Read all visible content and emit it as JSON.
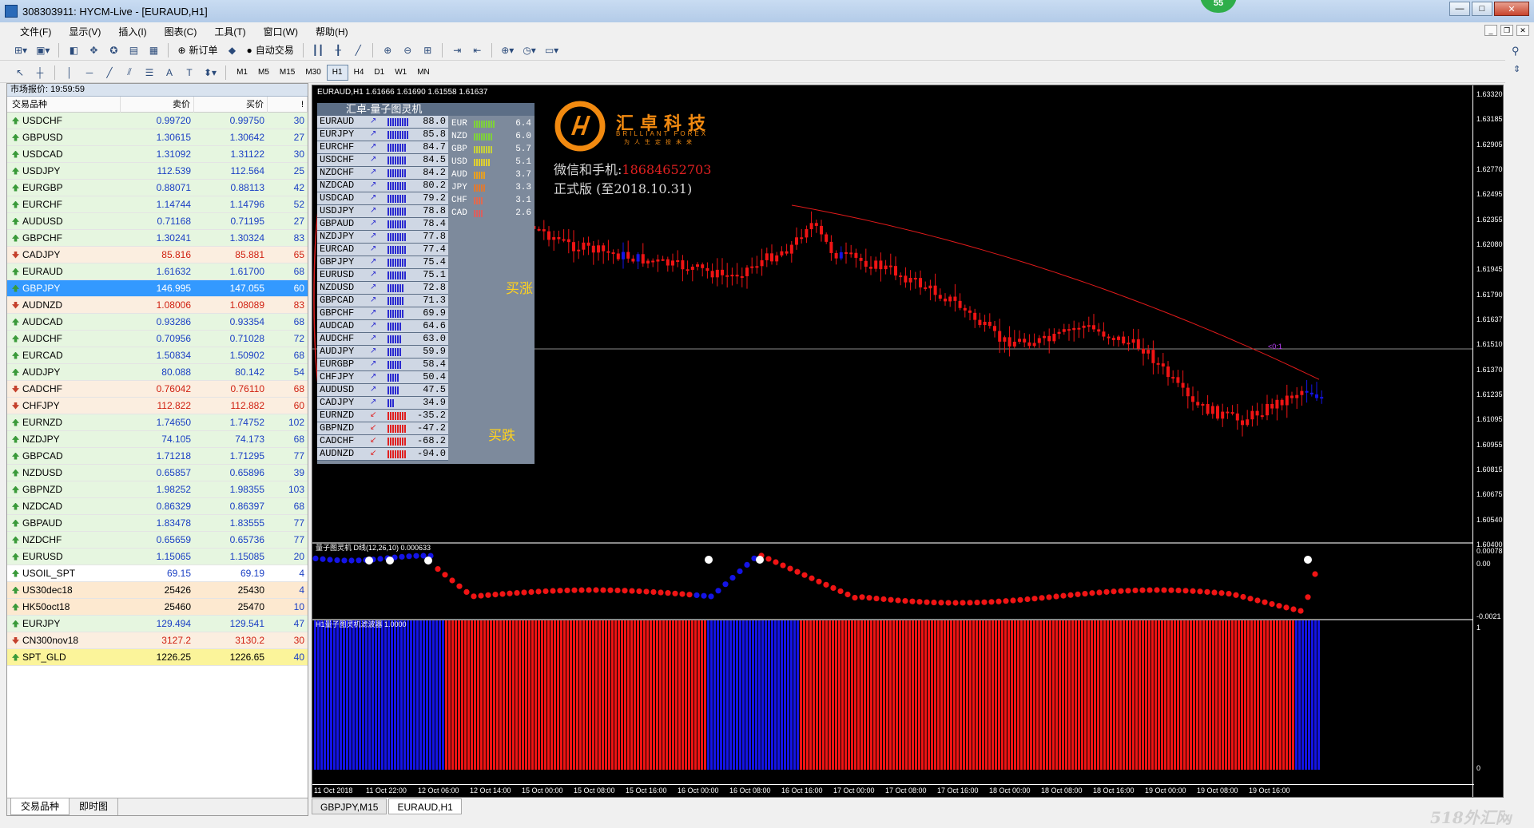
{
  "window": {
    "title": "308303911: HYCM-Live - [EURAUD,H1]",
    "badge": "55"
  },
  "menu": [
    "文件(F)",
    "显示(V)",
    "插入(I)",
    "图表(C)",
    "工具(T)",
    "窗口(W)",
    "帮助(H)"
  ],
  "toolbar": {
    "new_order": "新订单",
    "auto_trade": "自动交易",
    "timeframes": [
      "M1",
      "M5",
      "M15",
      "M30",
      "H1",
      "H4",
      "D1",
      "W1",
      "MN"
    ],
    "active_tf": "H1"
  },
  "market_watch": {
    "header": "市场报价: 19:59:59",
    "columns": [
      "交易品种",
      "卖价",
      "买价",
      "!"
    ],
    "rows": [
      {
        "sym": "USDCHF",
        "bid": "0.99720",
        "ask": "0.99750",
        "spread": "30",
        "state": "up"
      },
      {
        "sym": "GBPUSD",
        "bid": "1.30615",
        "ask": "1.30642",
        "spread": "27",
        "state": "up"
      },
      {
        "sym": "USDCAD",
        "bid": "1.31092",
        "ask": "1.31122",
        "spread": "30",
        "state": "up"
      },
      {
        "sym": "USDJPY",
        "bid": "112.539",
        "ask": "112.564",
        "spread": "25",
        "state": "up"
      },
      {
        "sym": "EURGBP",
        "bid": "0.88071",
        "ask": "0.88113",
        "spread": "42",
        "state": "up"
      },
      {
        "sym": "EURCHF",
        "bid": "1.14744",
        "ask": "1.14796",
        "spread": "52",
        "state": "up"
      },
      {
        "sym": "AUDUSD",
        "bid": "0.71168",
        "ask": "0.71195",
        "spread": "27",
        "state": "up"
      },
      {
        "sym": "GBPCHF",
        "bid": "1.30241",
        "ask": "1.30324",
        "spread": "83",
        "state": "up"
      },
      {
        "sym": "CADJPY",
        "bid": "85.816",
        "ask": "85.881",
        "spread": "65",
        "state": "down"
      },
      {
        "sym": "EURAUD",
        "bid": "1.61632",
        "ask": "1.61700",
        "spread": "68",
        "state": "up"
      },
      {
        "sym": "GBPJPY",
        "bid": "146.995",
        "ask": "147.055",
        "spread": "60",
        "state": "selected"
      },
      {
        "sym": "AUDNZD",
        "bid": "1.08006",
        "ask": "1.08089",
        "spread": "83",
        "state": "down"
      },
      {
        "sym": "AUDCAD",
        "bid": "0.93286",
        "ask": "0.93354",
        "spread": "68",
        "state": "up"
      },
      {
        "sym": "AUDCHF",
        "bid": "0.70956",
        "ask": "0.71028",
        "spread": "72",
        "state": "up"
      },
      {
        "sym": "EURCAD",
        "bid": "1.50834",
        "ask": "1.50902",
        "spread": "68",
        "state": "up"
      },
      {
        "sym": "AUDJPY",
        "bid": "80.088",
        "ask": "80.142",
        "spread": "54",
        "state": "up"
      },
      {
        "sym": "CADCHF",
        "bid": "0.76042",
        "ask": "0.76110",
        "spread": "68",
        "state": "down"
      },
      {
        "sym": "CHFJPY",
        "bid": "112.822",
        "ask": "112.882",
        "spread": "60",
        "state": "down"
      },
      {
        "sym": "EURNZD",
        "bid": "1.74650",
        "ask": "1.74752",
        "spread": "102",
        "state": "up"
      },
      {
        "sym": "NZDJPY",
        "bid": "74.105",
        "ask": "74.173",
        "spread": "68",
        "state": "up"
      },
      {
        "sym": "GBPCAD",
        "bid": "1.71218",
        "ask": "1.71295",
        "spread": "77",
        "state": "up"
      },
      {
        "sym": "NZDUSD",
        "bid": "0.65857",
        "ask": "0.65896",
        "spread": "39",
        "state": "up"
      },
      {
        "sym": "GBPNZD",
        "bid": "1.98252",
        "ask": "1.98355",
        "spread": "103",
        "state": "up"
      },
      {
        "sym": "NZDCAD",
        "bid": "0.86329",
        "ask": "0.86397",
        "spread": "68",
        "state": "up"
      },
      {
        "sym": "GBPAUD",
        "bid": "1.83478",
        "ask": "1.83555",
        "spread": "77",
        "state": "up"
      },
      {
        "sym": "NZDCHF",
        "bid": "0.65659",
        "ask": "0.65736",
        "spread": "77",
        "state": "up"
      },
      {
        "sym": "EURUSD",
        "bid": "1.15065",
        "ask": "1.15085",
        "spread": "20",
        "state": "up"
      },
      {
        "sym": "USOIL_SPT",
        "bid": "69.15",
        "ask": "69.19",
        "spread": "4",
        "state": "neutral"
      },
      {
        "sym": "US30dec18",
        "bid": "25426",
        "ask": "25430",
        "spread": "4",
        "state": "orange"
      },
      {
        "sym": "HK50oct18",
        "bid": "25460",
        "ask": "25470",
        "spread": "10",
        "state": "orange"
      },
      {
        "sym": "EURJPY",
        "bid": "129.494",
        "ask": "129.541",
        "spread": "47",
        "state": "up"
      },
      {
        "sym": "CN300nov18",
        "bid": "3127.2",
        "ask": "3130.2",
        "spread": "30",
        "state": "down"
      },
      {
        "sym": "SPT_GLD",
        "bid": "1226.25",
        "ask": "1226.65",
        "spread": "40",
        "state": "gold"
      }
    ],
    "tabs": [
      "交易品种",
      "即时图"
    ]
  },
  "chart": {
    "header": "EURAUD,H1  1.61666 1.61690 1.61558 1.61637",
    "panel_title": "汇卓-量子图灵机",
    "pairs": [
      {
        "p": "EURAUD",
        "v": "88.0",
        "s": "buy"
      },
      {
        "p": "EURJPY",
        "v": "85.8",
        "s": "buy"
      },
      {
        "p": "EURCHF",
        "v": "84.7",
        "s": "buy"
      },
      {
        "p": "USDCHF",
        "v": "84.5",
        "s": "buy"
      },
      {
        "p": "NZDCHF",
        "v": "84.2",
        "s": "buy"
      },
      {
        "p": "NZDCAD",
        "v": "80.2",
        "s": "buy"
      },
      {
        "p": "USDCAD",
        "v": "79.2",
        "s": "buy"
      },
      {
        "p": "USDJPY",
        "v": "78.8",
        "s": "buy"
      },
      {
        "p": "GBPAUD",
        "v": "78.4",
        "s": "buy"
      },
      {
        "p": "NZDJPY",
        "v": "77.8",
        "s": "buy"
      },
      {
        "p": "EURCAD",
        "v": "77.4",
        "s": "buy"
      },
      {
        "p": "GBPJPY",
        "v": "75.4",
        "s": "buy"
      },
      {
        "p": "EURUSD",
        "v": "75.1",
        "s": "buy"
      },
      {
        "p": "NZDUSD",
        "v": "72.8",
        "s": "buy"
      },
      {
        "p": "GBPCAD",
        "v": "71.3",
        "s": "buy"
      },
      {
        "p": "GBPCHF",
        "v": "69.9",
        "s": "buy"
      },
      {
        "p": "AUDCAD",
        "v": "64.6",
        "s": "buy"
      },
      {
        "p": "AUDCHF",
        "v": "63.0",
        "s": "buy"
      },
      {
        "p": "AUDJPY",
        "v": "59.9",
        "s": "buy"
      },
      {
        "p": "EURGBP",
        "v": "58.4",
        "s": "buy"
      },
      {
        "p": "CHFJPY",
        "v": "50.4",
        "s": "buy"
      },
      {
        "p": "AUDUSD",
        "v": "47.5",
        "s": "buy"
      },
      {
        "p": "CADJPY",
        "v": "34.9",
        "s": "buy"
      },
      {
        "p": "EURNZD",
        "v": "-35.2",
        "s": "sell"
      },
      {
        "p": "GBPNZD",
        "v": "-47.2",
        "s": "sell"
      },
      {
        "p": "CADCHF",
        "v": "-68.2",
        "s": "sell"
      },
      {
        "p": "AUDNZD",
        "v": "-94.0",
        "s": "sell"
      }
    ],
    "currencies": [
      {
        "c": "EUR",
        "v": "6.4",
        "col": "#7fd23a"
      },
      {
        "c": "NZD",
        "v": "6.0",
        "col": "#7fd23a"
      },
      {
        "c": "GBP",
        "v": "5.7",
        "col": "#c9d23a"
      },
      {
        "c": "USD",
        "v": "5.1",
        "col": "#e0d030"
      },
      {
        "c": "AUD",
        "v": "3.7",
        "col": "#e8a020"
      },
      {
        "c": "JPY",
        "v": "3.3",
        "col": "#e07a30"
      },
      {
        "c": "CHF",
        "v": "3.1",
        "col": "#e06a50"
      },
      {
        "c": "CAD",
        "v": "2.6",
        "col": "#d86060"
      }
    ],
    "brand": "汇卓科技",
    "brand_en": "BRILLIANT FOREX",
    "brand_cn2": "为人生定投未来",
    "contact_label": "微信和手机:",
    "contact_phone": "18684652703",
    "edition": "正式版 (至2018.10.31)",
    "annot_buy_up": "买涨",
    "annot_buy_down": "买跌",
    "price_labels": [
      "1.63320",
      "1.63185",
      "1.62905",
      "1.62770",
      "1.62495",
      "1.62355",
      "1.62080",
      "1.61945",
      "1.61790",
      "1.61637",
      "1.61510",
      "1.61370",
      "1.61235",
      "1.61095",
      "1.60955",
      "1.60815",
      "1.60675",
      "1.60540",
      "1.60400"
    ],
    "ind1_label": "量子图灵机 D线(12,26,10) 0.000633",
    "ind1_scale": [
      "0.00078",
      "0.00",
      "-0.0021"
    ],
    "ind2_label": "H1量子图灵机滤波器 1.0000",
    "ind2_scale": [
      "1",
      "0"
    ],
    "last_mark": "<0:1",
    "time_labels": [
      "11 Oct 2018",
      "11 Oct 22:00",
      "12 Oct 06:00",
      "12 Oct 14:00",
      "15 Oct 00:00",
      "15 Oct 08:00",
      "15 Oct 16:00",
      "16 Oct 00:00",
      "16 Oct 08:00",
      "16 Oct 16:00",
      "17 Oct 00:00",
      "17 Oct 08:00",
      "17 Oct 16:00",
      "18 Oct 00:00",
      "18 Oct 08:00",
      "18 Oct 16:00",
      "19 Oct 00:00",
      "19 Oct 08:00",
      "19 Oct 16:00"
    ]
  },
  "chart_tabs": [
    "GBPJPY,M15",
    "EURAUD,H1"
  ],
  "active_chart_tab": "EURAUD,H1",
  "watermark": "518外汇网",
  "colors": {
    "bull": "#1414e6",
    "bear": "#f01414",
    "ma": "#e01a1a",
    "bg": "#000000"
  }
}
